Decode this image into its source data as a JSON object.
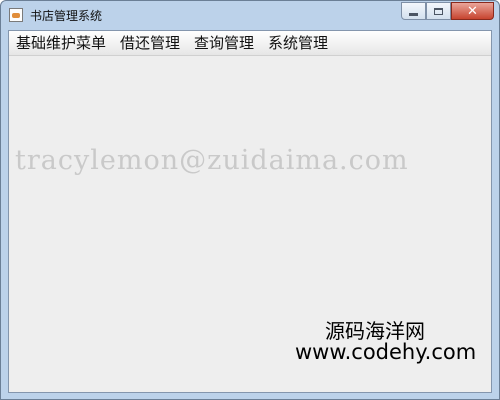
{
  "window": {
    "title": "书店管理系统",
    "icons": {
      "app": "java-cup-icon",
      "minimize": "minimize-icon",
      "maximize": "maximize-icon",
      "close": "close-icon"
    },
    "close_glyph": "✕"
  },
  "menubar": {
    "items": [
      {
        "label": "基础维护菜单"
      },
      {
        "label": "借还管理"
      },
      {
        "label": "查询管理"
      },
      {
        "label": "系统管理"
      }
    ]
  },
  "watermark": {
    "text": "tracylemon@zuidaima.com",
    "logo_cn": "源码海洋网",
    "logo_url": "www.codehy.com"
  },
  "colors": {
    "title_bar": "#bcd2ea",
    "client_bg": "#eeeeee",
    "close_button": "#c7442f"
  }
}
